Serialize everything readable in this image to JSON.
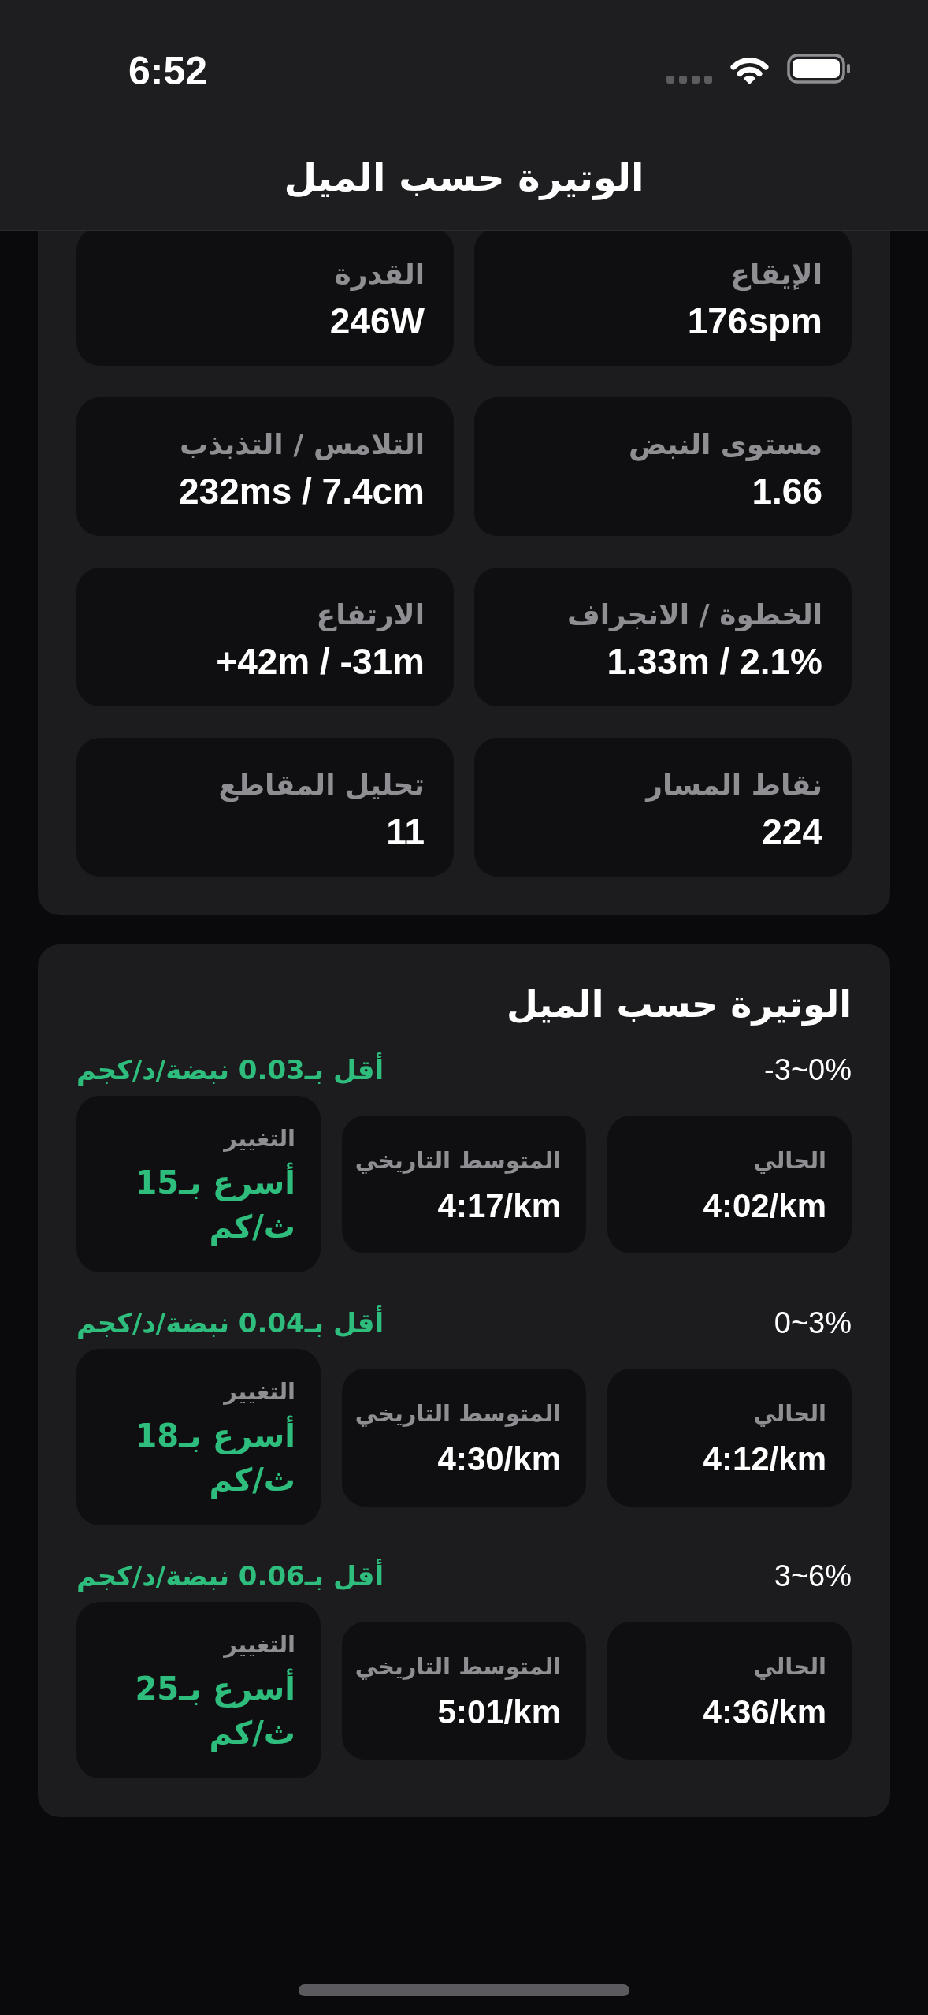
{
  "status_bar": {
    "time": "6:52"
  },
  "nav_bar": {
    "title": "الوتيرة حسب الميل"
  },
  "metrics": [
    {
      "label": "الإيقاع",
      "value": "176spm"
    },
    {
      "label": "القدرة",
      "value": "246W"
    },
    {
      "label": "مستوى النبض",
      "value": "1.66"
    },
    {
      "label": "التلامس / التذبذب",
      "value": "232ms / 7.4cm"
    },
    {
      "label": "الخطوة / الانجراف",
      "value": "1.33m / 2.1%"
    },
    {
      "label": "الارتفاع",
      "value": "+42m / -31m"
    },
    {
      "label": "نقاط المسار",
      "value": "224"
    },
    {
      "label": "تحليل المقاطع",
      "value": "11"
    }
  ],
  "slope_pace": {
    "title": "الوتيرة حسب الميل",
    "rows": [
      {
        "grade": "-3~0%",
        "heart_rate_note": "أقل بـ0.03 نبضة/د/كجم",
        "current": {
          "label": "الحالي",
          "value": "4:02/km"
        },
        "historical_average": {
          "label": "المتوسط التاريخي",
          "value": "4:17/km"
        },
        "change": {
          "label": "التغيير",
          "value": "أسرع بـ15 ث/كم"
        }
      },
      {
        "grade": "0~3%",
        "heart_rate_note": "أقل بـ0.04 نبضة/د/كجم",
        "current": {
          "label": "الحالي",
          "value": "4:12/km"
        },
        "historical_average": {
          "label": "المتوسط التاريخي",
          "value": "4:30/km"
        },
        "change": {
          "label": "التغيير",
          "value": "أسرع بـ18 ث/كم"
        }
      },
      {
        "grade": "3~6%",
        "heart_rate_note": "أقل بـ0.06 نبضة/د/كجم",
        "current": {
          "label": "الحالي",
          "value": "4:36/km"
        },
        "historical_average": {
          "label": "المتوسط التاريخي",
          "value": "5:01/km"
        },
        "change": {
          "label": "التغيير",
          "value": "أسرع بـ25 ث/كم"
        }
      }
    ]
  }
}
